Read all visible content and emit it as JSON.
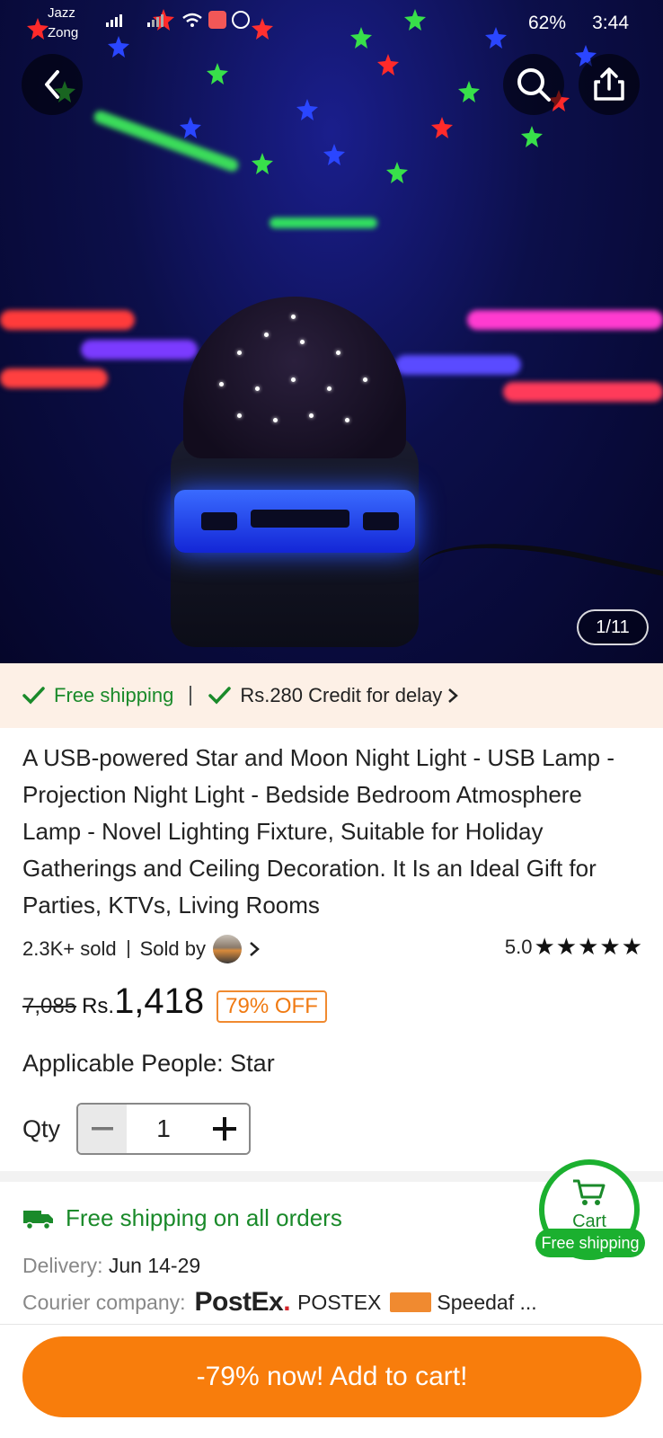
{
  "status_bar": {
    "carrier1": "Jazz",
    "carrier2": "Zong",
    "battery": "62%",
    "time": "3:44"
  },
  "gallery": {
    "counter": "1/11"
  },
  "promo": {
    "free_shipping": "Free shipping",
    "credit": "Rs.280 Credit for delay"
  },
  "product": {
    "title": "A USB-powered Star and Moon Night Light - USB Lamp - Projection Night Light - Bedside Bedroom Atmosphere Lamp - Novel Lighting Fixture, Suitable for Holiday Gatherings and Ceiling Decoration. It Is an Ideal Gift for Parties, KTVs, Living Rooms",
    "sold": "2.3K+ sold",
    "sold_by": "Sold by",
    "rating": "5.0",
    "stars": "★★★★★",
    "old_price": "7,085",
    "currency": "Rs.",
    "price": "1,418",
    "discount": "79% OFF",
    "applicable": "Applicable People: Star"
  },
  "quantity": {
    "label": "Qty",
    "value": "1"
  },
  "shipping": {
    "headline": "Free shipping on all orders",
    "delivery_label": "Delivery:",
    "delivery_value": "Jun 14-29",
    "courier_label": "Courier company:",
    "courier_logo": "PostEx",
    "courier1": "POSTEX",
    "courier2": "Speedaf ..."
  },
  "cart_badge": {
    "label": "Cart",
    "pill": "Free shipping"
  },
  "cta": {
    "label": "-79% now! Add to cart!"
  },
  "colors": {
    "brand_orange": "#f87d0c",
    "green": "#1a8a2a",
    "promo_bg": "#fdf0e6"
  }
}
